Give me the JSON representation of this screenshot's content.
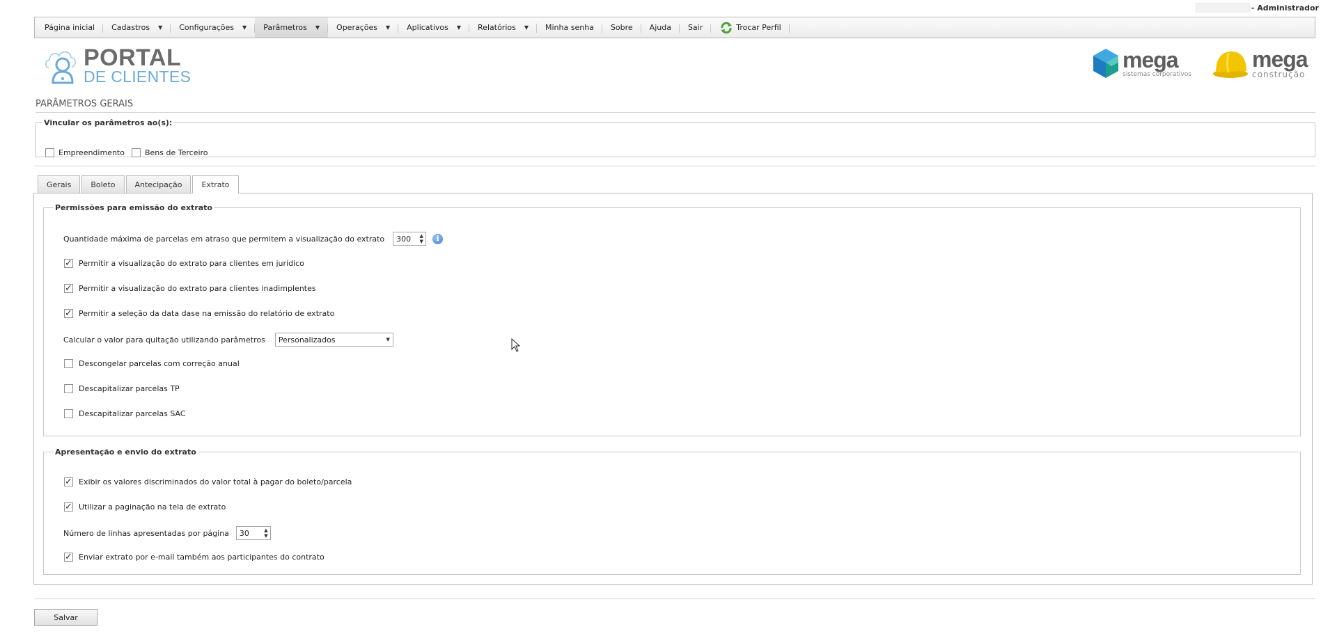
{
  "user": {
    "name": "- Administrador"
  },
  "menu": {
    "items": [
      {
        "label": "Página inicial",
        "caret": false
      },
      {
        "label": "Cadastros",
        "caret": true
      },
      {
        "label": "Configurações",
        "caret": true
      },
      {
        "label": "Parâmetros",
        "caret": true,
        "active": true
      },
      {
        "label": "Operações",
        "caret": true
      },
      {
        "label": "Aplicativos",
        "caret": true
      },
      {
        "label": "Relatórios",
        "caret": true
      },
      {
        "label": "Minha senha",
        "caret": false
      },
      {
        "label": "Sobre",
        "caret": false
      },
      {
        "label": "Ajuda",
        "caret": false
      },
      {
        "label": "Sair",
        "caret": false
      }
    ],
    "trocar_perfil": "Trocar Perfil"
  },
  "logos": {
    "portal_top": "PORTAL",
    "portal_bottom": "DE CLIENTES",
    "mega1_word": "mega",
    "mega1_sub": "sistemas corporativos",
    "mega2_word": "mega",
    "mega2_sub": "construção"
  },
  "page": {
    "title": "PARÂMETROS GERAIS"
  },
  "vincular": {
    "legend": "Vincular os parâmetros ao(s):",
    "options": [
      {
        "label": "Empreendimento",
        "checked": false
      },
      {
        "label": "Bens de Terceiro",
        "checked": false
      }
    ]
  },
  "tabs": [
    {
      "label": "Gerais",
      "active": false
    },
    {
      "label": "Boleto",
      "active": false
    },
    {
      "label": "Antecipação",
      "active": false
    },
    {
      "label": "Extrato",
      "active": true
    }
  ],
  "permissoes": {
    "legend": "Permissões para emissão do extrato",
    "max_parcelas_label": "Quantidade máxima de parcelas em atraso que permitem a visualização do extrato",
    "max_parcelas_value": "300",
    "juridico": {
      "label": "Permitir a visualização do extrato para clientes em jurídico",
      "checked": true
    },
    "inadimplentes": {
      "label": "Permitir a visualização do extrato para clientes inadimplentes",
      "checked": true
    },
    "data_base": {
      "label": "Permitir a seleção da data dase na emissão do relatório de extrato",
      "checked": true
    },
    "quitacao_label": "Calcular o valor para quitação utilizando parâmetros",
    "quitacao_value": "Personalizados",
    "descongelar": {
      "label": "Descongelar parcelas com correção anual",
      "checked": false
    },
    "descap_tp": {
      "label": "Descapitalizar parcelas TP",
      "checked": false
    },
    "descap_sac": {
      "label": "Descapitalizar parcelas SAC",
      "checked": false
    }
  },
  "apresentacao": {
    "legend": "Apresentação e envio do extrato",
    "discriminados": {
      "label": "Exibir os valores discriminados do valor total à pagar do boleto/parcela",
      "checked": true
    },
    "paginacao": {
      "label": "Utilizar a paginação na tela de extrato",
      "checked": true
    },
    "linhas_label": "Número de linhas apresentadas por página",
    "linhas_value": "30",
    "email": {
      "label": "Enviar extrato por e-mail também aos participantes do contrato",
      "checked": true
    }
  },
  "actions": {
    "save_label": "Salvar"
  },
  "colors": {
    "accent": "#6aaad8",
    "mega_blue": "#1f7bbf",
    "helmet_yellow": "#f2c500",
    "refresh_green": "#4aa23b"
  }
}
